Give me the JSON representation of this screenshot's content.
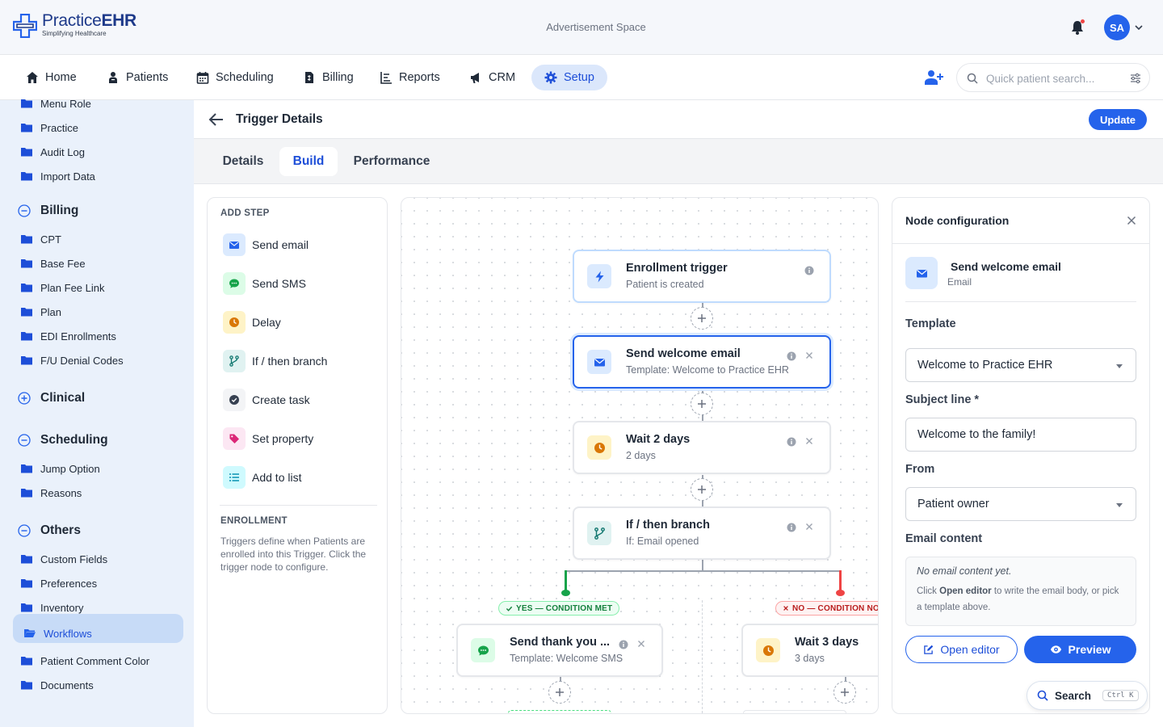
{
  "header": {
    "logo_name_a": "Practice",
    "logo_name_b": "EHR",
    "logo_tagline": "Simplifying Healthcare",
    "ad_text": "Advertisement Space",
    "avatar_initials": "SA"
  },
  "nav": {
    "items": [
      {
        "label": "Home"
      },
      {
        "label": "Patients"
      },
      {
        "label": "Scheduling"
      },
      {
        "label": "Billing"
      },
      {
        "label": "Reports"
      },
      {
        "label": "CRM"
      },
      {
        "label": "Setup"
      }
    ],
    "active": "Setup",
    "search_placeholder": "Quick patient search..."
  },
  "sidebar": {
    "items_top": [
      "Menu Role",
      "Practice",
      "Audit Log",
      "Import Data"
    ],
    "groups": [
      {
        "label": "Billing",
        "state": "expanded",
        "items": [
          "CPT",
          "Base Fee",
          "Plan Fee Link",
          "Plan",
          "EDI Enrollments",
          "F/U Denial Codes"
        ]
      },
      {
        "label": "Clinical",
        "state": "collapsed",
        "items": []
      },
      {
        "label": "Scheduling",
        "state": "expanded",
        "items": [
          "Jump Option",
          "Reasons"
        ]
      },
      {
        "label": "Others",
        "state": "expanded",
        "items": [
          "Custom Fields",
          "Preferences",
          "Inventory",
          "Workflows",
          "Patient Comment Color",
          "Documents"
        ]
      }
    ],
    "active_item": "Workflows"
  },
  "page": {
    "title": "Trigger Details",
    "update_label": "Update",
    "tabs": [
      "Details",
      "Build",
      "Performance"
    ],
    "active_tab": "Build"
  },
  "add_step": {
    "heading": "ADD STEP",
    "steps": [
      "Send email",
      "Send SMS",
      "Delay",
      "If / then branch",
      "Create task",
      "Set property",
      "Add to list"
    ],
    "enrollment_heading": "ENROLLMENT",
    "enrollment_text": "Triggers define when Patients are enrolled into this Trigger. Click the trigger node to configure."
  },
  "flow": {
    "nodes": [
      {
        "title": "Enrollment trigger",
        "sub": "Patient is created"
      },
      {
        "title": "Send welcome email",
        "sub": "Template: Welcome to Practice EHR"
      },
      {
        "title": "Wait 2 days",
        "sub": "2 days"
      },
      {
        "title": "If / then branch",
        "sub": "If: Email opened"
      },
      {
        "title": "Send thank you ...",
        "sub": "Template: Welcome SMS"
      },
      {
        "title": "Wait 3 days",
        "sub": "3 days"
      }
    ],
    "yes_label": "YES — CONDITION MET",
    "no_label": "NO — CONDITION NOT MET"
  },
  "config": {
    "title": "Node configuration",
    "node_title": "Send welcome email",
    "node_type": "Email",
    "template_label": "Template",
    "template_value": "Welcome to Practice EHR",
    "subject_label": "Subject line *",
    "subject_value": "Welcome to the family!",
    "from_label": "From",
    "from_value": "Patient owner",
    "content_label": "Email content",
    "empty_title": "No email content yet.",
    "empty_text_a": "Click",
    "empty_text_b": "Open editor",
    "empty_text_c": "to write the email body, or pick a template above.",
    "open_editor_label": "Open editor",
    "preview_label": "Preview"
  },
  "floating_search": {
    "label": "Search",
    "shortcut": "Ctrl K"
  },
  "colors": {
    "primary": "#2563eb",
    "sidebar_bg": "#eaf1fb",
    "yes_green": "#16a34a",
    "no_red": "#ef4444"
  }
}
